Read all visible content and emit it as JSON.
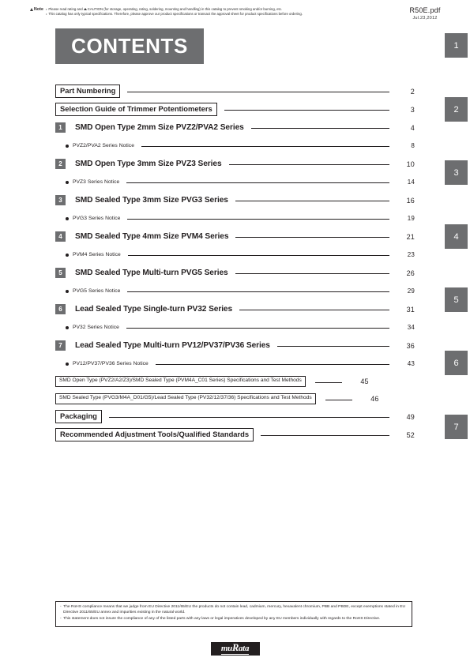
{
  "header": {
    "note_label": "Note",
    "note_lines": [
      "Please read rating and CAUTION (for storage, operating, rating, soldering, mounting and handling) in this catalog to prevent smoking and/or burning, etc.",
      "This catalog has only typical specifications. Therefore, please approve our product specifications or transact the approval sheet for product specifications before ordering."
    ],
    "note_line_1_pre": "Please read rating and ",
    "note_line_1_post": "CAUTION (for storage, operating, rating, soldering, mounting and handling) in this catalog to prevent smoking and/or burning, etc.",
    "document_file": "R50E.pdf",
    "document_date": "Jul.23,2012"
  },
  "title": "CONTENTS",
  "toc": {
    "boxed_top": [
      {
        "label": "Part Numbering",
        "page": "2"
      },
      {
        "label": "Selection Guide of Trimmer Potentiometers",
        "page": "3"
      }
    ],
    "chapters": [
      {
        "number": "1",
        "title": "SMD Open Type 2mm Size PVZ2/PVA2 Series",
        "page": "4",
        "sub_title": "PVZ2/PVA2 Series Notice",
        "sub_page": "8"
      },
      {
        "number": "2",
        "title": "SMD Open Type 3mm Size PVZ3 Series",
        "page": "10",
        "sub_title": "PVZ3 Series Notice",
        "sub_page": "14"
      },
      {
        "number": "3",
        "title": "SMD Sealed Type 3mm Size PVG3 Series",
        "page": "16",
        "sub_title": "PVG3 Series Notice",
        "sub_page": "19"
      },
      {
        "number": "4",
        "title": "SMD Sealed Type 4mm Size PVM4 Series",
        "page": "21",
        "sub_title": "PVM4 Series Notice",
        "sub_page": "23"
      },
      {
        "number": "5",
        "title": "SMD Sealed Type Multi-turn PVG5 Series",
        "page": "26",
        "sub_title": "PVG5 Series Notice",
        "sub_page": "29"
      },
      {
        "number": "6",
        "title": "Lead Sealed Type Single-turn PV32 Series",
        "page": "31",
        "sub_title": "PV32 Series Notice",
        "sub_page": "34"
      },
      {
        "number": "7",
        "title": "Lead Sealed Type Multi-turn PV12/PV37/PV36 Series",
        "page": "36",
        "sub_title": "PV12/PV37/PV36 Series Notice",
        "sub_page": "43"
      }
    ],
    "boxed_specs": [
      {
        "label": "SMD Open Type (PVZ2/A2/Z3)/SMD Sealed Type (PVM4A_C01 Series) Specifications and Test Methods",
        "page": "45"
      },
      {
        "label": "SMD Sealed Type (PVG3/M4A_D01/G5)/Lead Sealed Type (PV32/12/37/36) Specifications and Test Methods",
        "page": "46"
      }
    ],
    "boxed_bottom": [
      {
        "label": "Packaging",
        "page": "49"
      },
      {
        "label": "Recommended Adjustment Tools/Qualified Standards",
        "page": "52"
      }
    ]
  },
  "side_tabs": [
    "1",
    "2",
    "3",
    "4",
    "5",
    "6",
    "7"
  ],
  "rohs": {
    "items": [
      "The RoHS compliance means that we judge from EU Directive 2011/65/EU the products do not contain lead, cadmium, mercury, hexavalent chromium, PBB and PBDE, except exemptions stated in EU Directive 2011/65/EU annex and impurities existing in the natural world.",
      "This statement does not insure the compliance of any of the listed parts with any laws or legal imperatives developed by any EU members individually with regards to the RoHS Directive."
    ]
  },
  "logo": {
    "brand_prefix": "mu",
    "brand_cap": "R",
    "brand_suffix": "ata",
    "brand_full": "muRata"
  },
  "colors": {
    "gray_banner": "#6d6e70",
    "text": "#231f20"
  }
}
